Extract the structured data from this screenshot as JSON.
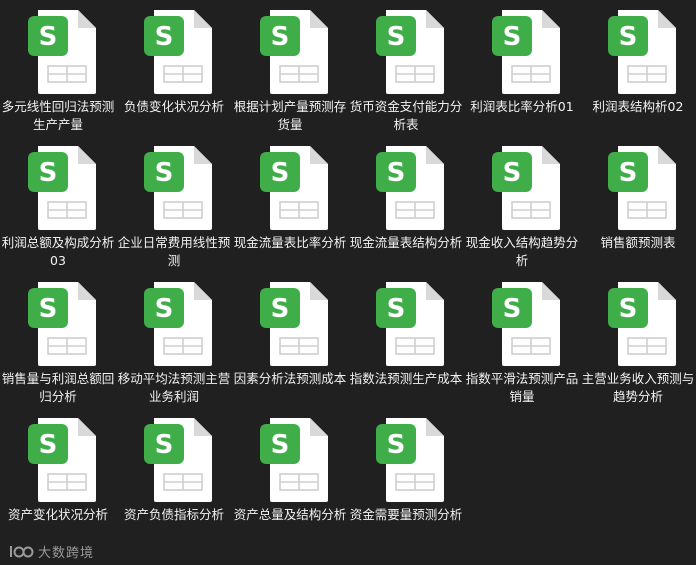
{
  "files": [
    {
      "name": "多元线性回归法预测生产产量",
      "icon": "spreadsheet-file-icon"
    },
    {
      "name": "负债变化状况分析",
      "icon": "spreadsheet-file-icon"
    },
    {
      "name": "根据计划产量预测存货量",
      "icon": "spreadsheet-file-icon"
    },
    {
      "name": "货币资金支付能力分析表",
      "icon": "spreadsheet-file-icon"
    },
    {
      "name": "利润表比率分析01",
      "icon": "spreadsheet-file-icon"
    },
    {
      "name": "利润表结构析02",
      "icon": "spreadsheet-file-icon"
    },
    {
      "name": "利润总额及构成分析03",
      "icon": "spreadsheet-file-icon"
    },
    {
      "name": "企业日常费用线性预测",
      "icon": "spreadsheet-file-icon"
    },
    {
      "name": "现金流量表比率分析",
      "icon": "spreadsheet-file-icon"
    },
    {
      "name": "现金流量表结构分析",
      "icon": "spreadsheet-file-icon"
    },
    {
      "name": "现金收入结构趋势分析",
      "icon": "spreadsheet-file-icon"
    },
    {
      "name": "销售额预测表",
      "icon": "spreadsheet-file-icon"
    },
    {
      "name": "销售量与利润总额回归分析",
      "icon": "spreadsheet-file-icon"
    },
    {
      "name": "移动平均法预测主营业务利润",
      "icon": "spreadsheet-file-icon"
    },
    {
      "name": "因素分析法预测成本",
      "icon": "spreadsheet-file-icon"
    },
    {
      "name": "指数法预测生产成本",
      "icon": "spreadsheet-file-icon"
    },
    {
      "name": "指数平滑法预测产品销量",
      "icon": "spreadsheet-file-icon"
    },
    {
      "name": "主营业务收入预测与趋势分析",
      "icon": "spreadsheet-file-icon"
    },
    {
      "name": "资产变化状况分析",
      "icon": "spreadsheet-file-icon"
    },
    {
      "name": "资产负债指标分析",
      "icon": "spreadsheet-file-icon"
    },
    {
      "name": "资产总量及结构分析",
      "icon": "spreadsheet-file-icon"
    },
    {
      "name": "资金需要量预测分析",
      "icon": "spreadsheet-file-icon"
    }
  ],
  "icon_badge_letter": "S",
  "colors": {
    "background": "#202020",
    "icon_green": "#3fae49",
    "page_white": "#ffffff",
    "page_fold": "#d9d9d9",
    "grid_line": "#cfcfcf",
    "label_text": "#f2f2f2"
  },
  "watermark": {
    "text": "大数跨境",
    "icon": "watermark-logo-icon"
  }
}
